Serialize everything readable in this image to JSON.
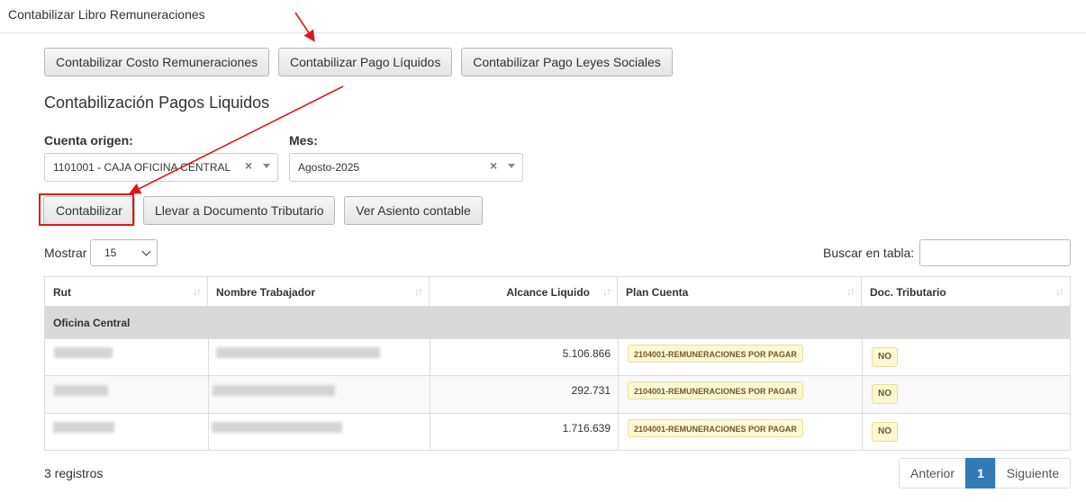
{
  "header": {
    "title": "Contabilizar Libro Remuneraciones"
  },
  "top_buttons": {
    "costo": "Contabilizar Costo Remuneraciones",
    "pago_liquidos": "Contabilizar Pago Líquidos",
    "leyes_sociales": "Contabilizar Pago Leyes Sociales"
  },
  "section_title": "Contabilización Pagos Liquidos",
  "filters": {
    "cuenta_label": "Cuenta origen:",
    "cuenta_value": "1101001 - CAJA OFICINA CENTRAL",
    "mes_label": "Mes:",
    "mes_value": "Agosto-2025",
    "clear_symbol": "×"
  },
  "actions": {
    "contabilizar": "Contabilizar",
    "llevar": "Llevar a Documento Tributario",
    "ver_asiento": "Ver Asiento contable"
  },
  "length": {
    "label": "Mostrar",
    "value": "15"
  },
  "search": {
    "label": "Buscar en tabla:",
    "value": ""
  },
  "table": {
    "columns": [
      "Rut",
      "Nombre Trabajador",
      "Alcance Liquido",
      "Plan Cuenta",
      "Doc. Tributario"
    ],
    "sort_icon": "↓↑",
    "group": "Oficina Central",
    "rows": [
      {
        "rut": "",
        "nombre": "",
        "alcance": "5.106.866",
        "plan": "2104001-REMUNERACIONES POR PAGAR",
        "doc": "NO"
      },
      {
        "rut": "",
        "nombre": "",
        "alcance": "292.731",
        "plan": "2104001-REMUNERACIONES POR PAGAR",
        "doc": "NO"
      },
      {
        "rut": "",
        "nombre": "",
        "alcance": "1.716.639",
        "plan": "2104001-REMUNERACIONES POR PAGAR",
        "doc": "NO"
      }
    ]
  },
  "footer": {
    "info": "3 registros",
    "prev": "Anterior",
    "page": "1",
    "next": "Siguiente"
  },
  "colors": {
    "annotation": "#e0171c",
    "active_page": "#337ab7",
    "badge_bg": "#fcf8d4"
  }
}
